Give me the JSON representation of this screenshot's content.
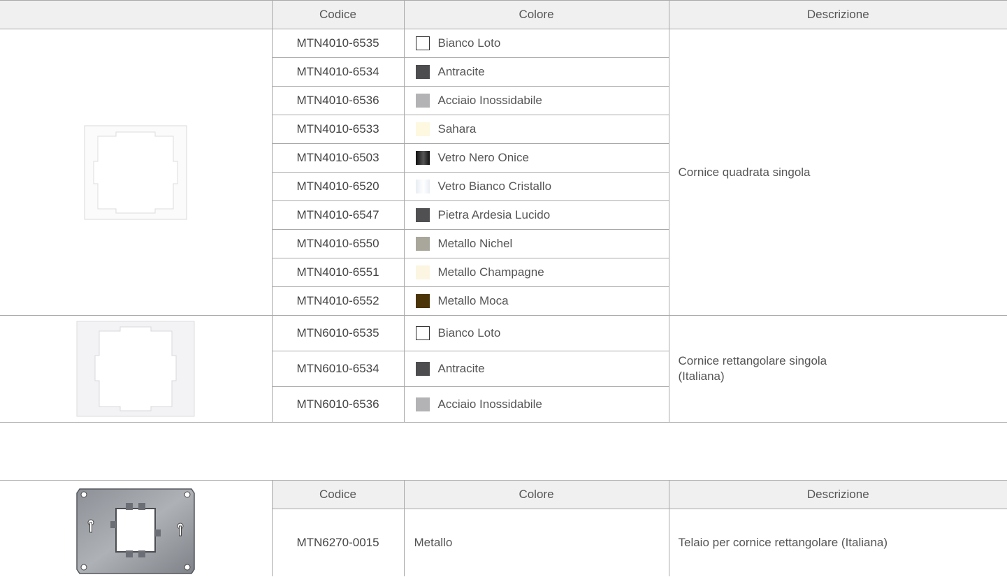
{
  "header": {
    "code": "Codice",
    "color": "Colore",
    "description": "Descrizione"
  },
  "group1": {
    "description": "Cornice quadrata singola",
    "image": "square-frame-white",
    "rows": [
      {
        "code": "MTN4010-6535",
        "color": "Bianco Loto",
        "swatch": "#ffffff"
      },
      {
        "code": "MTN4010-6534",
        "color": "Antracite",
        "swatch": "#4d4d4f"
      },
      {
        "code": "MTN4010-6536",
        "color": "Acciaio Inossidabile",
        "swatch": "#b3b3b5"
      },
      {
        "code": "MTN4010-6533",
        "color": "Sahara",
        "swatch": "#fdf8df"
      },
      {
        "code": "MTN4010-6503",
        "color": "Vetro Nero Onice",
        "swatch": "#111111"
      },
      {
        "code": "MTN4010-6520",
        "color": "Vetro Bianco Cristallo",
        "swatch": "#e8edf3"
      },
      {
        "code": "MTN4010-6547",
        "color": "Pietra Ardesia Lucido",
        "swatch": "#505052"
      },
      {
        "code": "MTN4010-6550",
        "color": "Metallo Nichel",
        "swatch": "#a9a69b"
      },
      {
        "code": "MTN4010-6551",
        "color": "Metallo Champagne",
        "swatch": "#fcf5e1"
      },
      {
        "code": "MTN4010-6552",
        "color": "Metallo Moca",
        "swatch": "#4b3407"
      }
    ]
  },
  "group2": {
    "description_line1": "Cornice rettangolare singola",
    "description_line2": "(Italiana)",
    "image": "rectangular-frame-white",
    "rows": [
      {
        "code": "MTN6010-6535",
        "color": "Bianco Loto",
        "swatch": "#ffffff"
      },
      {
        "code": "MTN6010-6534",
        "color": "Antracite",
        "swatch": "#4d4d4f"
      },
      {
        "code": "MTN6010-6536",
        "color": "Acciaio Inossidabile",
        "swatch": "#b3b3b5"
      }
    ]
  },
  "table2": {
    "image": "metal-mounting-plate",
    "row": {
      "code": "MTN6270-0015",
      "color": "Metallo",
      "description": "Telaio per cornice rettangolare (Italiana)"
    }
  }
}
